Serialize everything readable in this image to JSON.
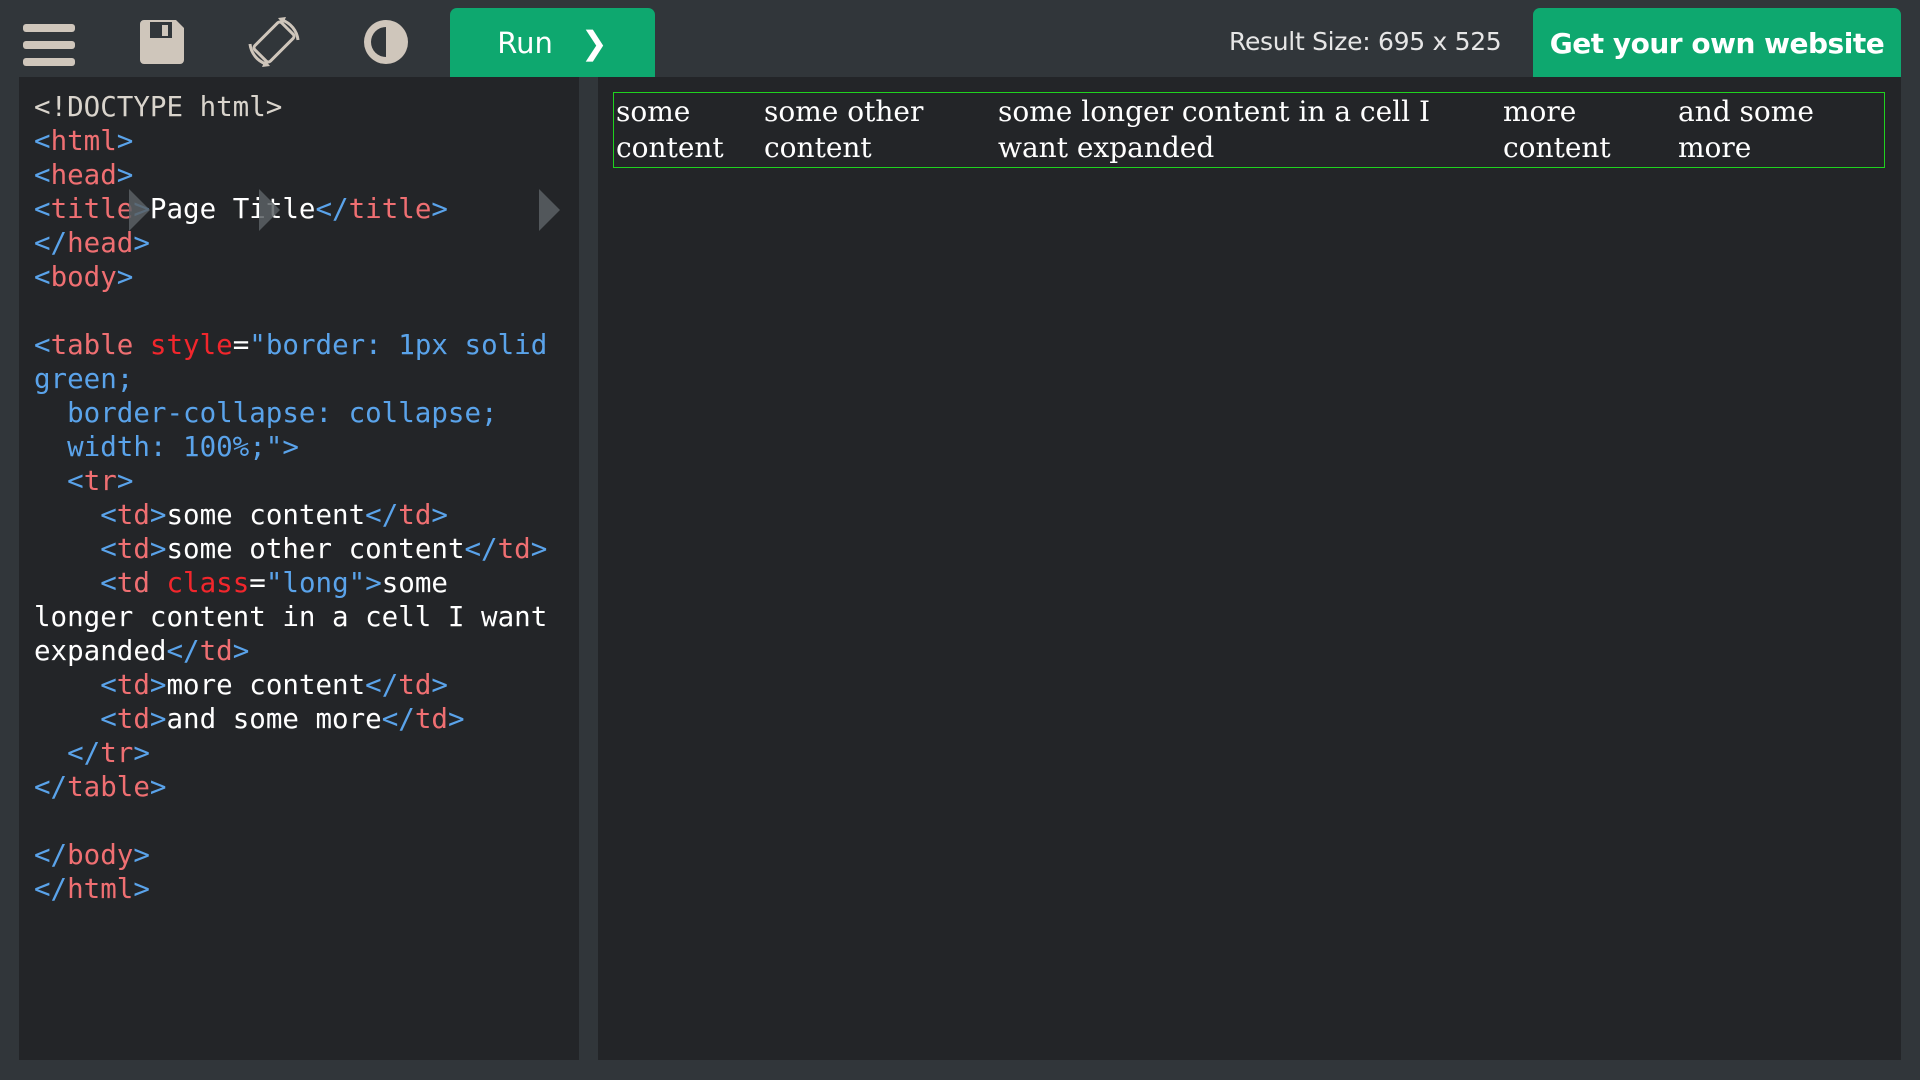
{
  "toolbar": {
    "icons": [
      "menu-icon",
      "save-icon",
      "rotate-icon",
      "contrast-icon"
    ],
    "run_label": "Run",
    "run_chevron": "❯",
    "result_size": "Result Size: 695 x 525",
    "own_website_label": "Get your own website"
  },
  "colors": {
    "accent": "#0ea86f",
    "bracket": "#5aa3ea",
    "tag": "#ef6f72",
    "attribute": "#f2262c",
    "table_border": "#1fd21f"
  },
  "editor": {
    "lines": [
      [
        [
          "doc",
          "<!DOCTYPE html>"
        ]
      ],
      [
        [
          "br",
          "<"
        ],
        [
          "tag",
          "html"
        ],
        [
          "br",
          ">"
        ]
      ],
      [
        [
          "br",
          "<"
        ],
        [
          "tag",
          "head"
        ],
        [
          "br",
          ">"
        ]
      ],
      [
        [
          "br",
          "<"
        ],
        [
          "tag",
          "title"
        ],
        [
          "br",
          ">"
        ],
        [
          "plain",
          "Page Title"
        ],
        [
          "br",
          "</"
        ],
        [
          "tag",
          "title"
        ],
        [
          "br",
          ">"
        ]
      ],
      [
        [
          "br",
          "</"
        ],
        [
          "tag",
          "head"
        ],
        [
          "br",
          ">"
        ]
      ],
      [
        [
          "br",
          "<"
        ],
        [
          "tag",
          "body"
        ],
        [
          "br",
          ">"
        ]
      ],
      [],
      [
        [
          "br",
          "<"
        ],
        [
          "tag",
          "table"
        ],
        [
          "plain",
          " "
        ],
        [
          "attr",
          "style"
        ],
        [
          "plain",
          "="
        ],
        [
          "val",
          "\"border: 1px solid"
        ]
      ],
      [
        [
          "val",
          "green;"
        ]
      ],
      [
        [
          "val",
          "  border-collapse: collapse;"
        ]
      ],
      [
        [
          "val",
          "  width: 100%;\""
        ],
        [
          "br",
          ">"
        ]
      ],
      [
        [
          "plain",
          "  "
        ],
        [
          "br",
          "<"
        ],
        [
          "tag",
          "tr"
        ],
        [
          "br",
          ">"
        ]
      ],
      [
        [
          "plain",
          "    "
        ],
        [
          "br",
          "<"
        ],
        [
          "tag",
          "td"
        ],
        [
          "br",
          ">"
        ],
        [
          "plain",
          "some content"
        ],
        [
          "br",
          "</"
        ],
        [
          "tag",
          "td"
        ],
        [
          "br",
          ">"
        ]
      ],
      [
        [
          "plain",
          "    "
        ],
        [
          "br",
          "<"
        ],
        [
          "tag",
          "td"
        ],
        [
          "br",
          ">"
        ],
        [
          "plain",
          "some other content"
        ],
        [
          "br",
          "</"
        ],
        [
          "tag",
          "td"
        ],
        [
          "br",
          ">"
        ]
      ],
      [
        [
          "plain",
          "    "
        ],
        [
          "br",
          "<"
        ],
        [
          "tag",
          "td"
        ],
        [
          "plain",
          " "
        ],
        [
          "attr",
          "class"
        ],
        [
          "plain",
          "="
        ],
        [
          "val",
          "\"long\""
        ],
        [
          "br",
          ">"
        ],
        [
          "plain",
          "some"
        ]
      ],
      [
        [
          "plain",
          "longer content in a cell I want"
        ]
      ],
      [
        [
          "plain",
          "expanded"
        ],
        [
          "br",
          "</"
        ],
        [
          "tag",
          "td"
        ],
        [
          "br",
          ">"
        ]
      ],
      [
        [
          "plain",
          "    "
        ],
        [
          "br",
          "<"
        ],
        [
          "tag",
          "td"
        ],
        [
          "br",
          ">"
        ],
        [
          "plain",
          "more content"
        ],
        [
          "br",
          "</"
        ],
        [
          "tag",
          "td"
        ],
        [
          "br",
          ">"
        ]
      ],
      [
        [
          "plain",
          "    "
        ],
        [
          "br",
          "<"
        ],
        [
          "tag",
          "td"
        ],
        [
          "br",
          ">"
        ],
        [
          "plain",
          "and some more"
        ],
        [
          "br",
          "</"
        ],
        [
          "tag",
          "td"
        ],
        [
          "br",
          ">"
        ]
      ],
      [
        [
          "plain",
          "  "
        ],
        [
          "br",
          "</"
        ],
        [
          "tag",
          "tr"
        ],
        [
          "br",
          ">"
        ]
      ],
      [
        [
          "br",
          "</"
        ],
        [
          "tag",
          "table"
        ],
        [
          "br",
          ">"
        ]
      ],
      [],
      [
        [
          "br",
          "</"
        ],
        [
          "tag",
          "body"
        ],
        [
          "br",
          ">"
        ]
      ],
      [
        [
          "br",
          "</"
        ],
        [
          "tag",
          "html"
        ],
        [
          "br",
          ">"
        ]
      ]
    ]
  },
  "result": {
    "table": {
      "cells": [
        [
          "some",
          "content"
        ],
        [
          "some other",
          "content"
        ],
        [
          "some longer content in a cell I",
          "want expanded"
        ],
        [
          "more",
          "content"
        ],
        [
          "and some",
          "more"
        ]
      ]
    }
  }
}
